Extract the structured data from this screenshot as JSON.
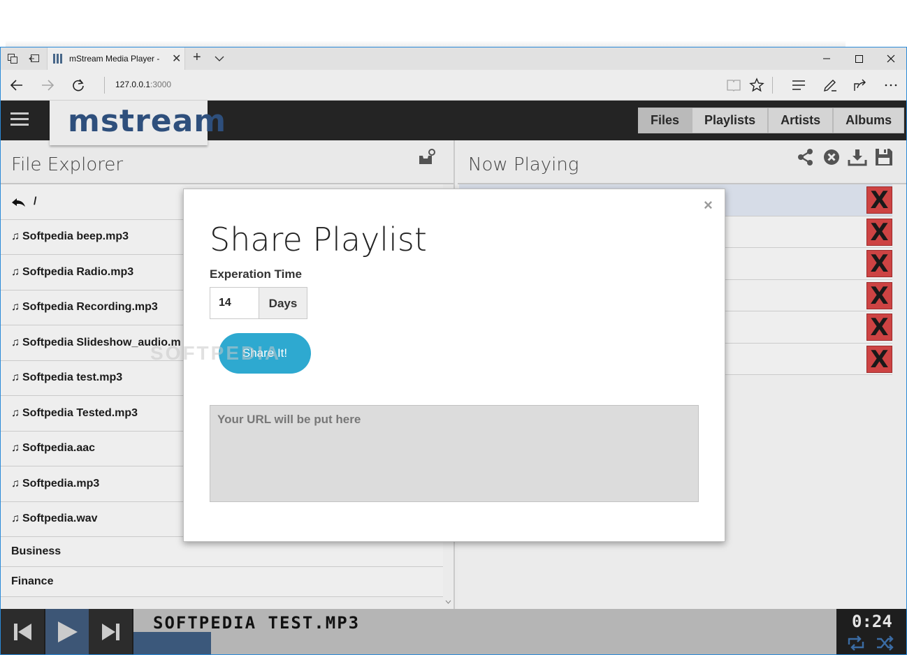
{
  "browser": {
    "tab_title": "mStream Media Player -",
    "url_host": "127.0.0.1",
    "url_port": ":3000"
  },
  "app": {
    "logo": "mstream",
    "nav_tabs": [
      "Files",
      "Playlists",
      "Artists",
      "Albums"
    ],
    "active_nav": "Files"
  },
  "file_explorer": {
    "title": "File Explorer",
    "path": "/",
    "files": [
      "Softpedia beep.mp3",
      "Softpedia Radio.mp3",
      "Softpedia Recording.mp3",
      "Softpedia Slideshow_audio.m",
      "Softpedia test.mp3",
      "Softpedia Tested.mp3",
      "Softpedia.aac",
      "Softpedia.mp3",
      "Softpedia.wav"
    ],
    "folders": [
      "Business",
      "Finance"
    ]
  },
  "now_playing": {
    "title": "Now Playing",
    "remove_label": "X",
    "row_count": 6
  },
  "player": {
    "track": "SOFTPEDIA TEST.MP3",
    "time": "0:24",
    "progress_fraction": 0.11
  },
  "modal": {
    "title": "Share Playlist",
    "close": "×",
    "field_label": "Experation Time",
    "days_value": "14",
    "days_addon": "Days",
    "share_button": "Share It!",
    "url_placeholder": "Your URL will be put here"
  },
  "watermark": "SOFTPEDIA",
  "colors": {
    "accent": "#2ea9d0",
    "remove": "#d24545",
    "logo": "#2e4f7c",
    "header": "#252525"
  }
}
